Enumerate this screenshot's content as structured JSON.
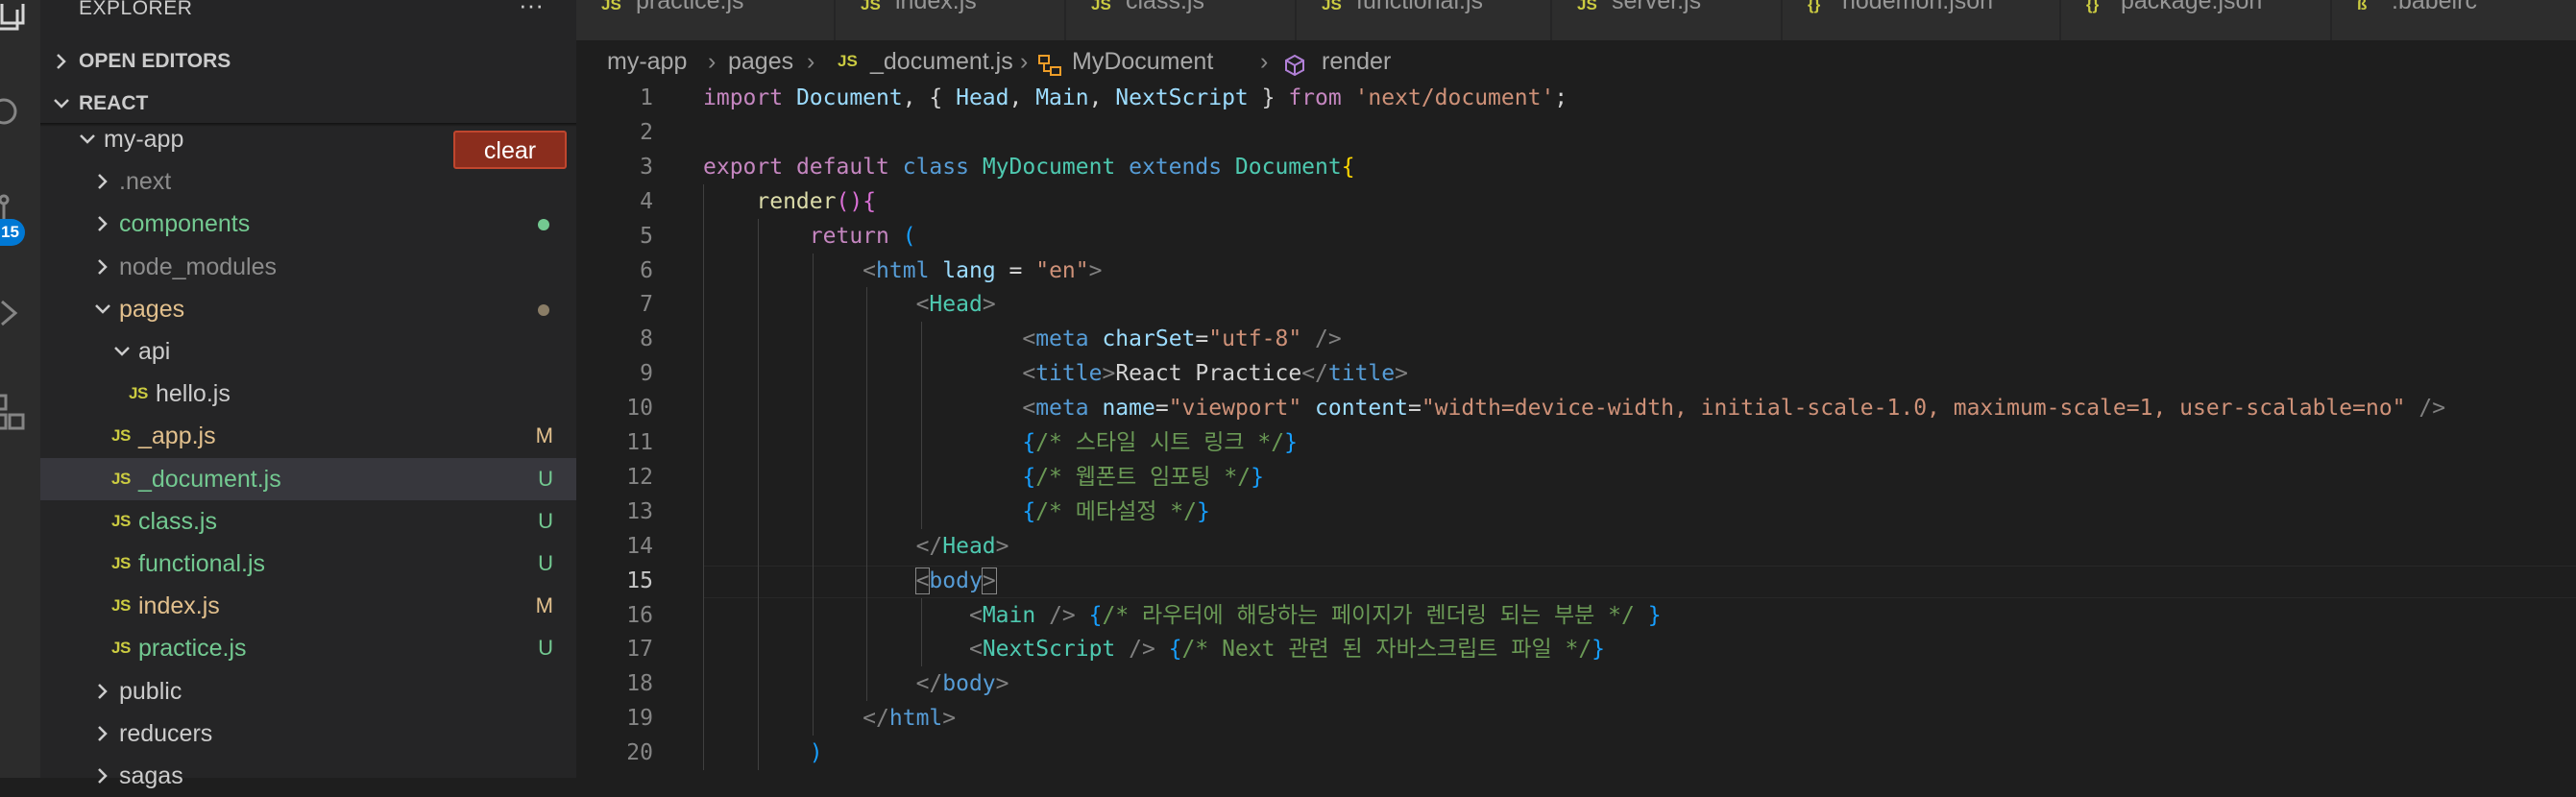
{
  "sidebar": {
    "title": "EXPLORER",
    "more": "···",
    "sections": {
      "open_editors": "OPEN EDITORS",
      "project": "REACT"
    },
    "clear_button": "clear",
    "tree": [
      {
        "name": "my-app",
        "type": "folder",
        "open": true,
        "depth": 0,
        "color": "#cccccc"
      },
      {
        "name": ".next",
        "type": "folder",
        "open": false,
        "depth": 1,
        "color": "#8c8c8c"
      },
      {
        "name": "components",
        "type": "folder",
        "open": false,
        "depth": 1,
        "color": "#73c991",
        "dot": "#73c991"
      },
      {
        "name": "node_modules",
        "type": "folder",
        "open": false,
        "depth": 1,
        "color": "#8c8c8c"
      },
      {
        "name": "pages",
        "type": "folder",
        "open": true,
        "depth": 1,
        "color": "#e2c08d",
        "dot": "#8a7d66"
      },
      {
        "name": "api",
        "type": "folder",
        "open": true,
        "depth": 2,
        "color": "#cccccc"
      },
      {
        "name": "hello.js",
        "type": "file",
        "depth": 3,
        "color": "#cccccc"
      },
      {
        "name": "_app.js",
        "type": "file",
        "depth": 2,
        "color": "#e2c08d",
        "status": "M"
      },
      {
        "name": "_document.js",
        "type": "file",
        "depth": 2,
        "color": "#73c991",
        "status": "U",
        "selected": true
      },
      {
        "name": "class.js",
        "type": "file",
        "depth": 2,
        "color": "#73c991",
        "status": "U"
      },
      {
        "name": "functional.js",
        "type": "file",
        "depth": 2,
        "color": "#73c991",
        "status": "U"
      },
      {
        "name": "index.js",
        "type": "file",
        "depth": 2,
        "color": "#e2c08d",
        "status": "M"
      },
      {
        "name": "practice.js",
        "type": "file",
        "depth": 2,
        "color": "#73c991",
        "status": "U"
      },
      {
        "name": "public",
        "type": "folder",
        "open": false,
        "depth": 1,
        "color": "#cccccc"
      },
      {
        "name": "reducers",
        "type": "folder",
        "open": false,
        "depth": 1,
        "color": "#cccccc"
      },
      {
        "name": "sagas",
        "type": "folder",
        "open": false,
        "depth": 1,
        "color": "#cccccc"
      }
    ],
    "js_label": "JS"
  },
  "activity": {
    "badge": "15"
  },
  "tabs": [
    {
      "label": "practice.js",
      "icon": "JS",
      "icon_color": "#cbcb41"
    },
    {
      "label": "index.js",
      "icon": "JS",
      "icon_color": "#cbcb41"
    },
    {
      "label": "class.js",
      "icon": "JS",
      "icon_color": "#cbcb41"
    },
    {
      "label": "functional.js",
      "icon": "JS",
      "icon_color": "#cbcb41"
    },
    {
      "label": "server.js",
      "icon": "JS",
      "icon_color": "#cbcb41"
    },
    {
      "label": "nodemon.json",
      "icon": "{}",
      "icon_color": "#cbcb41"
    },
    {
      "label": "package.json",
      "icon": "{}",
      "icon_color": "#cbcb41"
    },
    {
      "label": ".babelrc",
      "icon": "ß",
      "icon_color": "#cbcb41"
    }
  ],
  "breadcrumbs": {
    "items": [
      "my-app",
      "pages",
      "_document.js",
      "MyDocument",
      "render"
    ],
    "file_icon": "JS",
    "separator": "›"
  },
  "editor": {
    "active_line": 15,
    "lines": [
      {
        "n": "1",
        "tokens": [
          [
            "import ",
            "kw-c"
          ],
          [
            "Document",
            "var"
          ],
          [
            ", { ",
            "pun"
          ],
          [
            "Head",
            "var"
          ],
          [
            ", ",
            "pun"
          ],
          [
            "Main",
            "var"
          ],
          [
            ", ",
            "pun"
          ],
          [
            "NextScript",
            "var"
          ],
          [
            " } ",
            "pun"
          ],
          [
            "from ",
            "kw-c"
          ],
          [
            "'next/document'",
            "str"
          ],
          [
            ";",
            "pun"
          ]
        ]
      },
      {
        "n": "2",
        "tokens": []
      },
      {
        "n": "3",
        "tokens": [
          [
            "export ",
            "kw-c"
          ],
          [
            "default ",
            "kw-c"
          ],
          [
            "class ",
            "kw-b"
          ],
          [
            "MyDocument ",
            "cls"
          ],
          [
            "extends ",
            "kw-b"
          ],
          [
            "Document",
            "cls"
          ],
          [
            "{",
            "brk"
          ]
        ]
      },
      {
        "n": "4",
        "tokens": [
          [
            "    ",
            "pun"
          ],
          [
            "render",
            "fn"
          ],
          [
            "()",
            "brk2"
          ],
          [
            "{",
            "brk2"
          ]
        ]
      },
      {
        "n": "5",
        "tokens": [
          [
            "        ",
            "pun"
          ],
          [
            "return ",
            "kw-c"
          ],
          [
            "(",
            "brk3"
          ]
        ]
      },
      {
        "n": "6",
        "tokens": [
          [
            "            ",
            "pun"
          ],
          [
            "<",
            "tagb"
          ],
          [
            "html ",
            "kw-b"
          ],
          [
            "lang ",
            "var"
          ],
          [
            "= ",
            "pun"
          ],
          [
            "\"en\"",
            "str"
          ],
          [
            ">",
            "tagb"
          ]
        ]
      },
      {
        "n": "7",
        "tokens": [
          [
            "                ",
            "pun"
          ],
          [
            "<",
            "tagb"
          ],
          [
            "Head",
            "cls"
          ],
          [
            ">",
            "tagb"
          ]
        ]
      },
      {
        "n": "8",
        "tokens": [
          [
            "                        ",
            "pun"
          ],
          [
            "<",
            "tagb"
          ],
          [
            "meta ",
            "kw-b"
          ],
          [
            "charSet",
            "var"
          ],
          [
            "=",
            "pun"
          ],
          [
            "\"utf-8\"",
            "str"
          ],
          [
            " />",
            "tagb"
          ]
        ]
      },
      {
        "n": "9",
        "tokens": [
          [
            "                        ",
            "pun"
          ],
          [
            "<",
            "tagb"
          ],
          [
            "title",
            "kw-b"
          ],
          [
            ">",
            "tagb"
          ],
          [
            "React Practice",
            "pun"
          ],
          [
            "</",
            "tagb"
          ],
          [
            "title",
            "kw-b"
          ],
          [
            ">",
            "tagb"
          ]
        ]
      },
      {
        "n": "10",
        "tokens": [
          [
            "                        ",
            "pun"
          ],
          [
            "<",
            "tagb"
          ],
          [
            "meta ",
            "kw-b"
          ],
          [
            "name",
            "var"
          ],
          [
            "=",
            "pun"
          ],
          [
            "\"viewport\"",
            "str"
          ],
          [
            " ",
            "pun"
          ],
          [
            "content",
            "var"
          ],
          [
            "=",
            "pun"
          ],
          [
            "\"width=device-width, initial-scale-1.0, maximum-scale=1, user-scalable=no\"",
            "str"
          ],
          [
            " />",
            "tagb"
          ]
        ]
      },
      {
        "n": "11",
        "tokens": [
          [
            "                        ",
            "pun"
          ],
          [
            "{",
            "brk3"
          ],
          [
            "/* 스타일 시트 링크 */",
            "cm"
          ],
          [
            "}",
            "brk3"
          ]
        ]
      },
      {
        "n": "12",
        "tokens": [
          [
            "                        ",
            "pun"
          ],
          [
            "{",
            "brk3"
          ],
          [
            "/* 웹폰트 임포팅 */",
            "cm"
          ],
          [
            "}",
            "brk3"
          ]
        ]
      },
      {
        "n": "13",
        "tokens": [
          [
            "                        ",
            "pun"
          ],
          [
            "{",
            "brk3"
          ],
          [
            "/* 메타설정 */",
            "cm"
          ],
          [
            "}",
            "brk3"
          ]
        ]
      },
      {
        "n": "14",
        "tokens": [
          [
            "                ",
            "pun"
          ],
          [
            "</",
            "tagb"
          ],
          [
            "Head",
            "cls"
          ],
          [
            ">",
            "tagb"
          ]
        ]
      },
      {
        "n": "15",
        "tokens": [
          [
            "                ",
            "pun"
          ],
          [
            "<",
            "tagb box"
          ],
          [
            "body",
            "kw-b"
          ],
          [
            ">",
            "tagb box"
          ]
        ]
      },
      {
        "n": "16",
        "tokens": [
          [
            "                    ",
            "pun"
          ],
          [
            "<",
            "tagb"
          ],
          [
            "Main ",
            "cls"
          ],
          [
            "/> ",
            "tagb"
          ],
          [
            "{",
            "brk3"
          ],
          [
            "/* 라우터에 해당하는 페이지가 렌더링 되는 부분 */ ",
            "cm"
          ],
          [
            "}",
            "brk3"
          ]
        ]
      },
      {
        "n": "17",
        "tokens": [
          [
            "                    ",
            "pun"
          ],
          [
            "<",
            "tagb"
          ],
          [
            "NextScript ",
            "cls"
          ],
          [
            "/> ",
            "tagb"
          ],
          [
            "{",
            "brk3"
          ],
          [
            "/* Next 관련 된 자바스크립트 파일 */",
            "cm"
          ],
          [
            "}",
            "brk3"
          ]
        ]
      },
      {
        "n": "18",
        "tokens": [
          [
            "                ",
            "pun"
          ],
          [
            "</",
            "tagb"
          ],
          [
            "body",
            "kw-b"
          ],
          [
            ">",
            "tagb"
          ]
        ]
      },
      {
        "n": "19",
        "tokens": [
          [
            "            ",
            "pun"
          ],
          [
            "</",
            "tagb"
          ],
          [
            "html",
            "kw-b"
          ],
          [
            ">",
            "tagb"
          ]
        ]
      },
      {
        "n": "20",
        "tokens": [
          [
            "        ",
            "pun"
          ],
          [
            ")",
            "brk3"
          ]
        ]
      }
    ]
  }
}
